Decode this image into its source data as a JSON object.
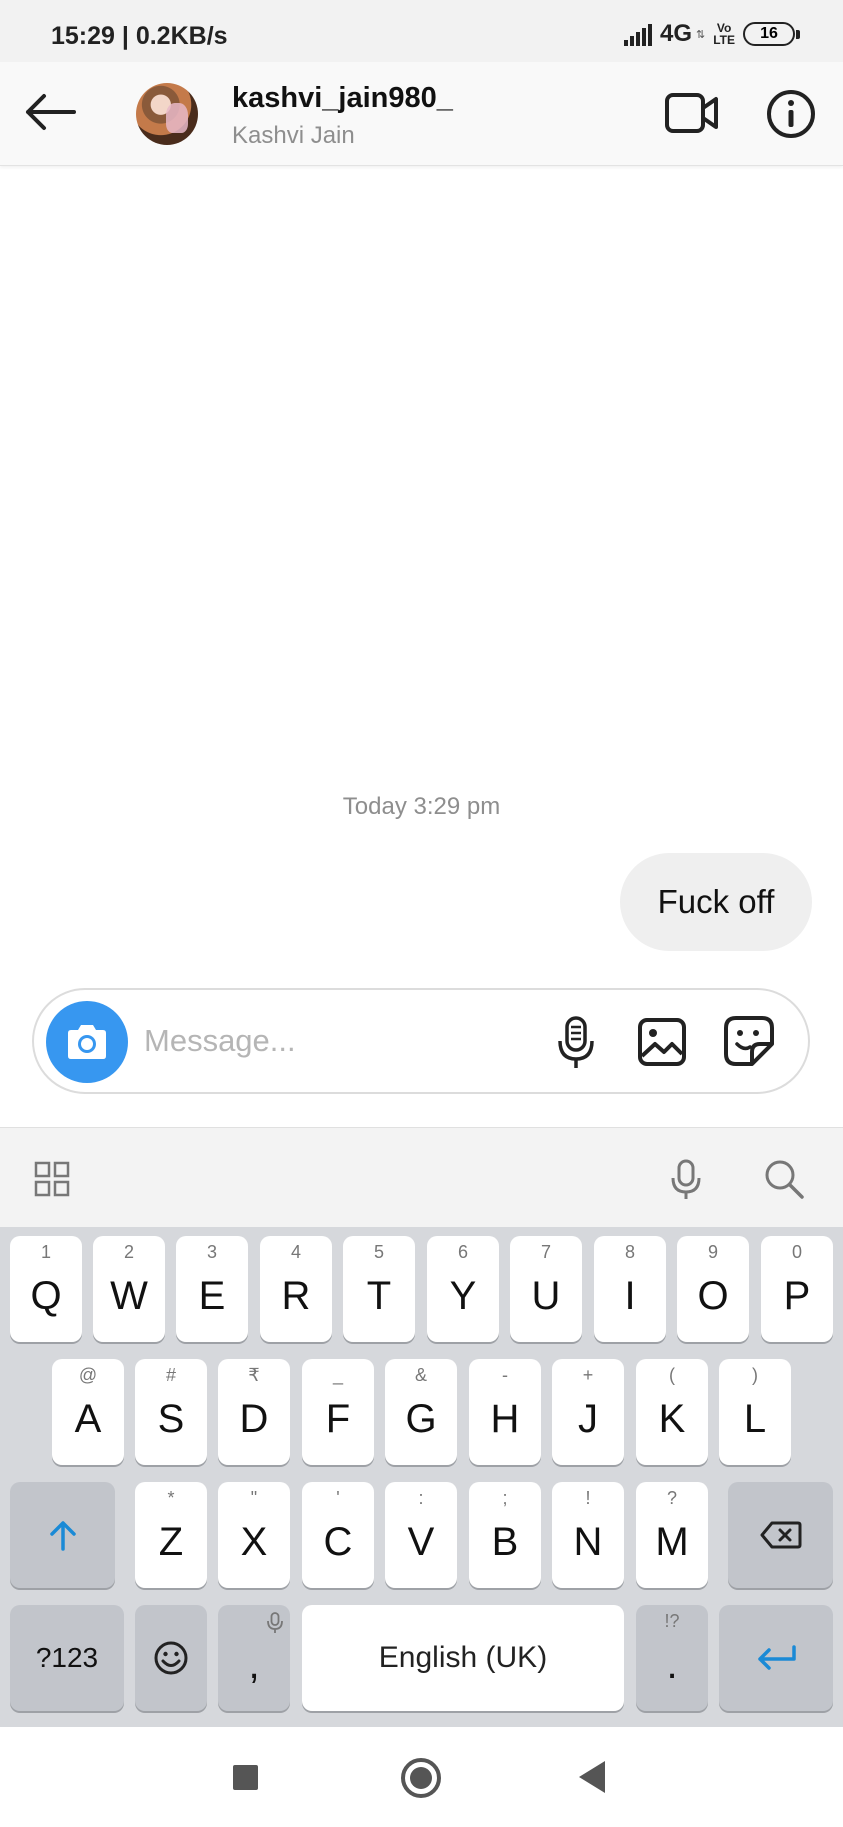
{
  "status_bar": {
    "left_text": "15:29 | 0.2KB/s",
    "network": "4G",
    "volte_top": "Vo",
    "volte_bottom": "LTE",
    "battery": "16"
  },
  "header": {
    "username": "kashvi_jain980_",
    "full_name": "Kashvi Jain",
    "back_icon": "arrow-left-icon",
    "video_icon": "video-camera-icon",
    "info_icon": "info-icon"
  },
  "chat": {
    "timestamp": "Today 3:29 pm",
    "messages": [
      {
        "text": "Fuck off",
        "sender": "me"
      }
    ]
  },
  "composer": {
    "placeholder": "Message...",
    "camera_icon": "camera-icon",
    "mic_icon": "microphone-icon",
    "gallery_icon": "gallery-icon",
    "sticker_icon": "sticker-icon",
    "accent_color": "#3797f0"
  },
  "keyboard": {
    "row1": [
      {
        "main": "Q",
        "sec": "1"
      },
      {
        "main": "W",
        "sec": "2"
      },
      {
        "main": "E",
        "sec": "3"
      },
      {
        "main": "R",
        "sec": "4"
      },
      {
        "main": "T",
        "sec": "5"
      },
      {
        "main": "Y",
        "sec": "6"
      },
      {
        "main": "U",
        "sec": "7"
      },
      {
        "main": "I",
        "sec": "8"
      },
      {
        "main": "O",
        "sec": "9"
      },
      {
        "main": "P",
        "sec": "0"
      }
    ],
    "row2": [
      {
        "main": "A",
        "sec": "@"
      },
      {
        "main": "S",
        "sec": "#"
      },
      {
        "main": "D",
        "sec": "₹"
      },
      {
        "main": "F",
        "sec": "_"
      },
      {
        "main": "G",
        "sec": "&"
      },
      {
        "main": "H",
        "sec": "-"
      },
      {
        "main": "J",
        "sec": "+"
      },
      {
        "main": "K",
        "sec": "("
      },
      {
        "main": "L",
        "sec": ")"
      }
    ],
    "row3": [
      {
        "main": "Z",
        "sec": "*"
      },
      {
        "main": "X",
        "sec": "\""
      },
      {
        "main": "C",
        "sec": "'"
      },
      {
        "main": "V",
        "sec": ":"
      },
      {
        "main": "B",
        "sec": ";"
      },
      {
        "main": "N",
        "sec": "!"
      },
      {
        "main": "M",
        "sec": "?"
      }
    ],
    "symbols_key": "?123",
    "comma_key": ",",
    "space_key": "English (UK)",
    "period_key": ".",
    "period_sec": "!?",
    "accent_color": "#1a8ad6"
  }
}
